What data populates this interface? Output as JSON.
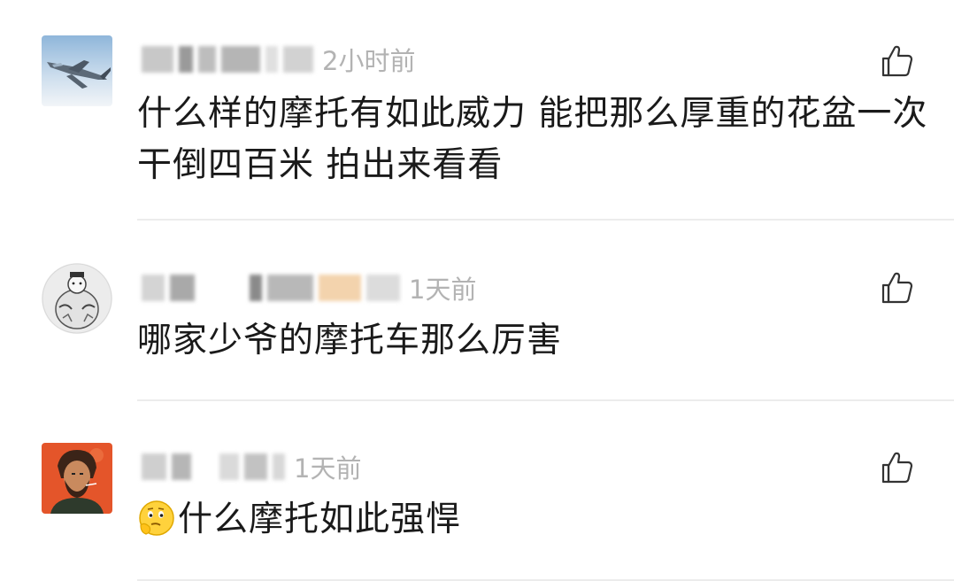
{
  "comments": [
    {
      "time": "2小时前",
      "text": "什么样的摩托有如此威力 能把那么厚重的花盆一次干倒四百米 拍出来看看",
      "avatar": "fighter-jet-avatar"
    },
    {
      "time": "1天前",
      "text": "哪家少爷的摩托车那么厉害",
      "avatar": "sketch-character-avatar"
    },
    {
      "time": "1天前",
      "text": "什么摩托如此强悍",
      "emoji": "thinking-face-emoji",
      "avatar": "bearded-man-avatar"
    }
  ],
  "icons": {
    "like": "thumbs-up-icon"
  },
  "colors": {
    "text": "#1a1a1a",
    "time": "#b3b3b3",
    "divider": "#ececec",
    "like_icon": "#333333"
  }
}
